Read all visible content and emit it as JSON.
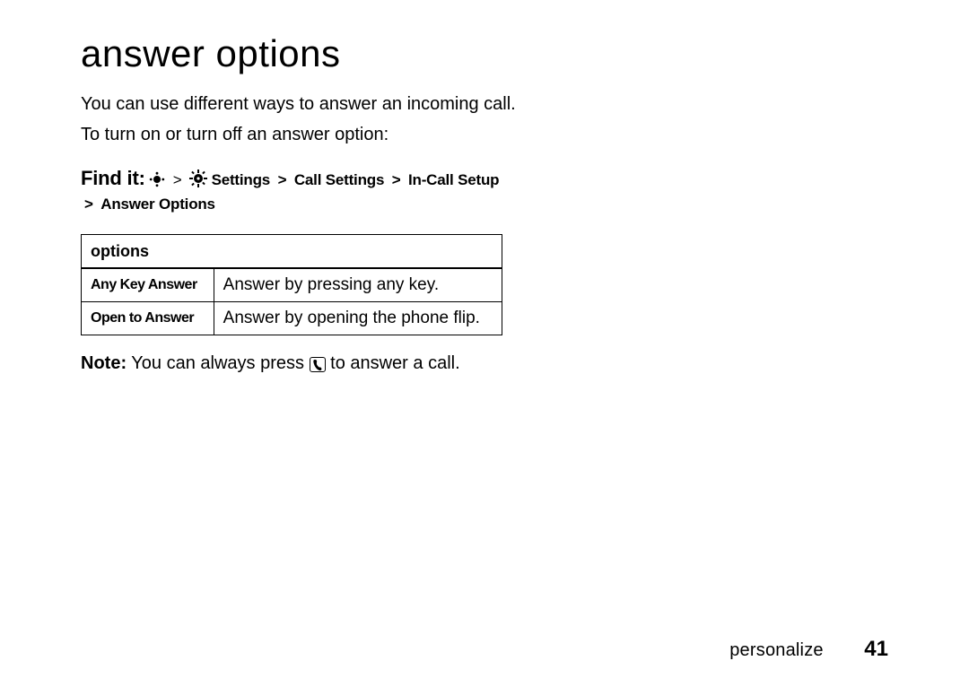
{
  "title": "answer options",
  "intro1": "You can use different ways to answer an incoming call.",
  "intro2": "To turn on or turn off an answer option:",
  "findit": {
    "label": "Find it:",
    "sep": ">",
    "path": [
      "Settings",
      "Call Settings",
      "In-Call Setup"
    ],
    "tail": "Answer Options"
  },
  "table": {
    "header": "options",
    "rows": [
      {
        "key": "Any Key Answer",
        "val": "Answer by pressing any key."
      },
      {
        "key": "Open to Answer",
        "val": "Answer by opening the phone flip."
      }
    ]
  },
  "note": {
    "label": "Note:",
    "before": " You can always press ",
    "after": " to answer a call."
  },
  "footer": {
    "section": "personalize",
    "page": "41"
  }
}
